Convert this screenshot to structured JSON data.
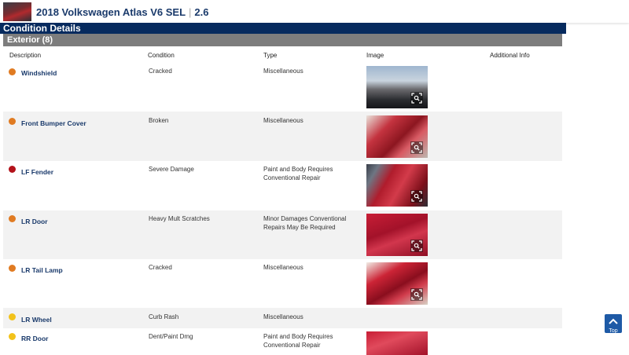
{
  "header": {
    "vehicle": "2018 Volkswagen Atlas V6 SEL",
    "separator": "|",
    "grade": "2.6"
  },
  "nav": {
    "title": "Condition Details"
  },
  "section": {
    "title": "Exterior (8)"
  },
  "columns": [
    "Description",
    "Condition",
    "Type",
    "Image",
    "Additional Info"
  ],
  "rows": [
    {
      "description": "Windshield",
      "condition": "Cracked",
      "type": "Miscellaneous",
      "severity_color": "#e07b22"
    },
    {
      "description": "Front Bumper Cover",
      "condition": "Broken",
      "type": "Miscellaneous",
      "severity_color": "#e07b22"
    },
    {
      "description": "LF Fender",
      "condition": "Severe Damage",
      "type_line1": "Paint and Body Requires",
      "type_line2": "Conventional Repair",
      "severity_color": "#b3121a"
    },
    {
      "description": "LR Door",
      "condition": "Heavy Mult Scratches",
      "type_line1": "Minor Damages Conventional",
      "type_line2": "Repairs May Be Required",
      "severity_color": "#e07b22"
    },
    {
      "description": "LR Tail Lamp",
      "condition": "Cracked",
      "type": "Miscellaneous",
      "severity_color": "#e07b22"
    },
    {
      "description": "LR Wheel",
      "condition": "Curb Rash",
      "type": "Miscellaneous",
      "severity_color": "#f2c21b"
    },
    {
      "description": "RR Door",
      "condition": "Dent/Paint Dmg",
      "type_line1": "Paint and Body Requires",
      "type_line2": "Conventional Repair",
      "severity_color": "#f2c21b"
    }
  ],
  "top_button": {
    "label": "Top"
  }
}
